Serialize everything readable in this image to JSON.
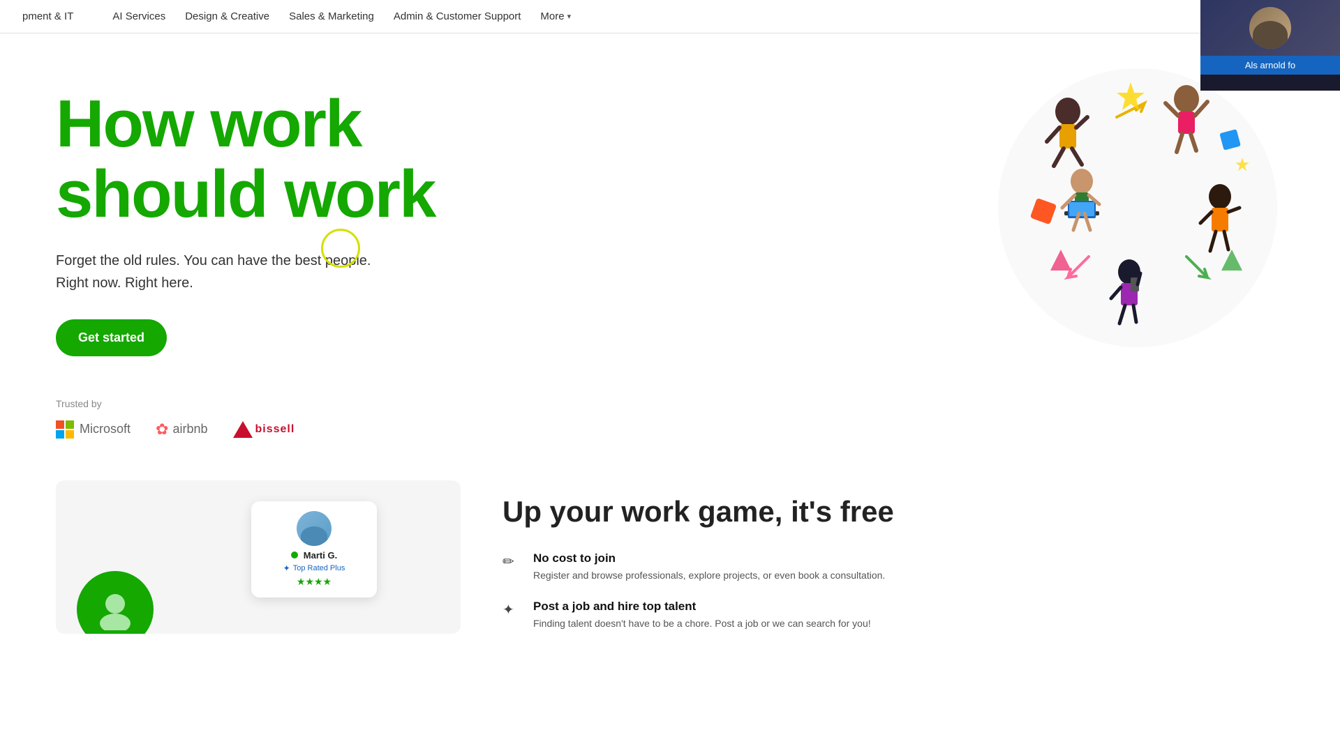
{
  "nav": {
    "partial_left": "pment & IT",
    "items": [
      {
        "id": "ai-services",
        "label": "AI Services"
      },
      {
        "id": "design-creative",
        "label": "Design & Creative"
      },
      {
        "id": "sales-marketing",
        "label": "Sales & Marketing"
      },
      {
        "id": "admin-customer",
        "label": "Admin & Customer Support"
      },
      {
        "id": "more",
        "label": "More"
      }
    ]
  },
  "video_overlay": {
    "label": "Als arnold fo"
  },
  "hero": {
    "title_line1": "How work",
    "title_line2": "should work",
    "subtitle_line1": "Forget the old rules. You can have the best people.",
    "subtitle_line2": "Right now. Right here.",
    "cta_label": "Get started",
    "trusted_label": "Trusted by",
    "logos": [
      {
        "id": "microsoft",
        "name": "Microsoft"
      },
      {
        "id": "airbnb",
        "name": "airbnb"
      },
      {
        "id": "bissell",
        "name": "bissell"
      }
    ]
  },
  "bottom": {
    "profile": {
      "name": "Marti G.",
      "badge": "Top Rated Plus",
      "online": true,
      "stars": "★★★★"
    },
    "upsell_title": "Up your work game, it's free",
    "features": [
      {
        "id": "no-cost",
        "icon": "✏",
        "title": "No cost to join",
        "desc": "Register and browse professionals, explore projects, or even book a consultation."
      },
      {
        "id": "post-job",
        "icon": "✦",
        "title": "Post a job and hire top talent",
        "desc": "Finding talent doesn't have to be a chore. Post a job or we can search for you!"
      }
    ]
  }
}
